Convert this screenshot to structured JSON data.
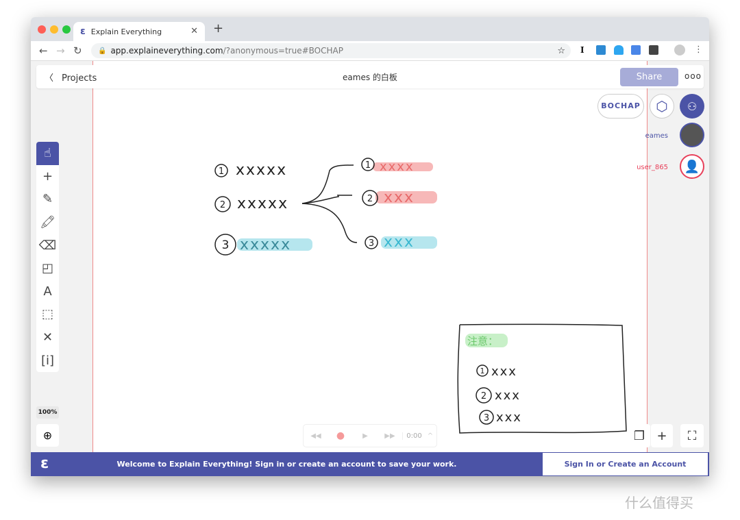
{
  "browser": {
    "tab_title": "Explain Everything",
    "url_host": "app.explaineverything.com",
    "url_rest": "/?anonymous=true#BOCHAP"
  },
  "header": {
    "back_label": "Projects",
    "board_title": "eames 的白板",
    "share_label": "Share",
    "more_label": "ooo"
  },
  "session": {
    "code": "BOCHAP"
  },
  "users": [
    {
      "name": "eames",
      "color": "#4b53a6"
    },
    {
      "name": "user_865",
      "color": "#e8405a"
    }
  ],
  "toolbar": {
    "tools": [
      "hand-icon",
      "plus-icon",
      "pen-icon",
      "highlighter-icon",
      "eraser-icon",
      "shapes-icon",
      "text-icon",
      "select-icon",
      "laser-icon",
      "insert-icon"
    ],
    "zoom": "100%"
  },
  "player": {
    "time": "0:00"
  },
  "banner": {
    "message": "Welcome to Explain Everything! Sign in or create an account to save your work.",
    "signin_label": "Sign In or Create an Account"
  },
  "canvas": {
    "left_items": [
      {
        "num": "1",
        "marks": "xxxxx"
      },
      {
        "num": "2",
        "marks": "xxxxx"
      },
      {
        "num": "3",
        "marks": "xxxxx"
      }
    ],
    "right_items": [
      {
        "num": "1",
        "marks": "xxxx"
      },
      {
        "num": "2",
        "marks": "xxx"
      },
      {
        "num": "3",
        "marks": "xxx"
      }
    ],
    "note": {
      "heading": "注意：",
      "items": [
        {
          "num": "1",
          "marks": "xxx"
        },
        {
          "num": "2",
          "marks": "xxx"
        },
        {
          "num": "3",
          "marks": "xxx"
        }
      ]
    }
  },
  "colors": {
    "accent": "#4b53a6",
    "pink_highlight": "#f7b8b8",
    "blue_highlight": "#b6e6ee",
    "green_highlight": "#c8f0c8"
  },
  "watermark": "什么值得买"
}
